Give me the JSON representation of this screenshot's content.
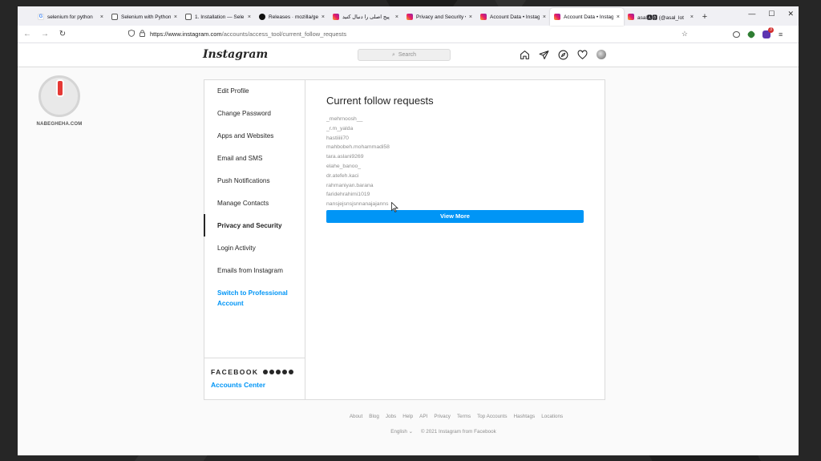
{
  "browser": {
    "tabs": [
      {
        "title": "selenium for python",
        "favicon": "google",
        "active": false
      },
      {
        "title": "Selenium with Python",
        "favicon": "doc",
        "active": false
      },
      {
        "title": "1. Installation — Sele",
        "favicon": "doc",
        "active": false
      },
      {
        "title": "Releases · mozilla/gec",
        "favicon": "github",
        "active": false
      },
      {
        "title": "پیج اصلی را دنبال کنید",
        "favicon": "instagram",
        "active": false
      },
      {
        "title": "Privacy and Security •",
        "favicon": "instagram",
        "active": false
      },
      {
        "title": "Account Data • Instag",
        "favicon": "instagram",
        "active": false
      },
      {
        "title": "Account Data • Instag",
        "favicon": "instagram",
        "active": true
      },
      {
        "title": "asal🅰🅱 (@asal_lot",
        "favicon": "instagram",
        "active": false
      }
    ],
    "close_glyph": "×",
    "new_tab_glyph": "+",
    "window_controls": [
      "—",
      "☐",
      "✕"
    ],
    "nav": {
      "back": "←",
      "forward": "→",
      "reload": "↻"
    },
    "url_host": "https://www.instagram.com",
    "url_path": "/accounts/access_tool/current_follow_requests",
    "star_icon": "☆",
    "extension_badge": "3",
    "menu_icon": "≡"
  },
  "watermark": {
    "text": "NABEGHEHA.COM"
  },
  "header": {
    "logo": "Instagram",
    "search_placeholder": "Search",
    "search_icon": "⌕",
    "nav_icons": [
      "home-icon",
      "direct-icon",
      "explore-icon",
      "activity-heart-icon",
      "profile-avatar"
    ]
  },
  "sidebar": {
    "items": [
      {
        "label": "Edit Profile",
        "active": false
      },
      {
        "label": "Change Password",
        "active": false
      },
      {
        "label": "Apps and Websites",
        "active": false
      },
      {
        "label": "Email and SMS",
        "active": false
      },
      {
        "label": "Push Notifications",
        "active": false
      },
      {
        "label": "Manage Contacts",
        "active": false
      },
      {
        "label": "Privacy and Security",
        "active": true
      },
      {
        "label": "Login Activity",
        "active": false
      },
      {
        "label": "Emails from Instagram",
        "active": false
      }
    ],
    "pro_link": "Switch to Professional Account",
    "facebook_word": "FACEBOOK",
    "accounts_center": "Accounts Center"
  },
  "main": {
    "title": "Current follow requests",
    "requests": [
      "_mehrnoosh__",
      "_r.m_yalda",
      "hastiiiii70",
      "mahbobeh.mohammadi58",
      "tara.aslani9269",
      "elahe_banoo_",
      "dr.atefeh.kaci",
      "rahmaniyan.barana",
      "faridehrahimi1019",
      "nansjejsnsjsnnanajajanns"
    ],
    "view_more_label": "View More"
  },
  "footer": {
    "links": [
      "About",
      "Blog",
      "Jobs",
      "Help",
      "API",
      "Privacy",
      "Terms",
      "Top Accounts",
      "Hashtags",
      "Locations"
    ],
    "language": "English",
    "language_chevron": "⌄",
    "copyright": "© 2021 Instagram from Facebook"
  },
  "colors": {
    "accent_blue": "#0095f6",
    "text_primary": "#262626",
    "text_secondary": "#8e8e8e",
    "border": "#dbdbdb"
  }
}
